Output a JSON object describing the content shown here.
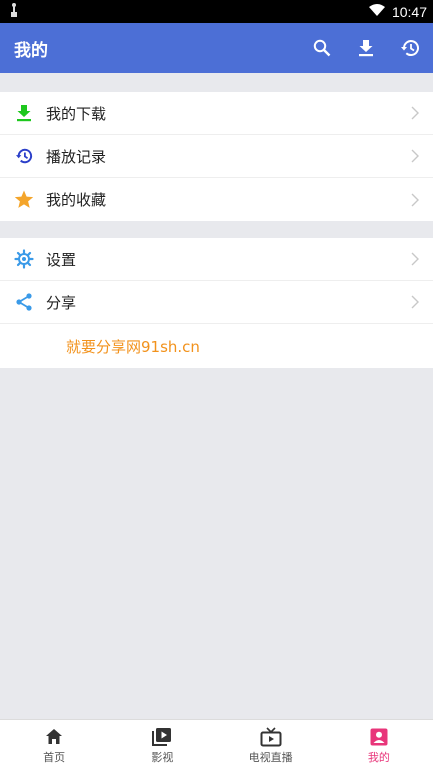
{
  "status_bar": {
    "time": "10:47"
  },
  "app_bar": {
    "title": "我的"
  },
  "menu_group_1": [
    {
      "label": "我的下载",
      "icon": "download-icon",
      "color": "#1ec81e"
    },
    {
      "label": "播放记录",
      "icon": "history-icon",
      "color": "#2b3fc9"
    },
    {
      "label": "我的收藏",
      "icon": "star-icon",
      "color": "#f4a52b"
    }
  ],
  "menu_group_2": [
    {
      "label": "设置",
      "icon": "gear-icon",
      "color": "#3a9ae8"
    },
    {
      "label": "分享",
      "icon": "share-icon",
      "color": "#3a9ae8"
    }
  ],
  "promo": {
    "text": "就要分享网91sh.cn"
  },
  "bottom_nav": [
    {
      "label": "首页",
      "icon": "home-icon"
    },
    {
      "label": "影视",
      "icon": "video-icon"
    },
    {
      "label": "电视直播",
      "icon": "tv-icon"
    },
    {
      "label": "我的",
      "icon": "profile-icon",
      "active": true
    }
  ],
  "colors": {
    "primary": "#4c6fd6",
    "active_tab": "#e8357a",
    "promo": "#f2921c"
  }
}
